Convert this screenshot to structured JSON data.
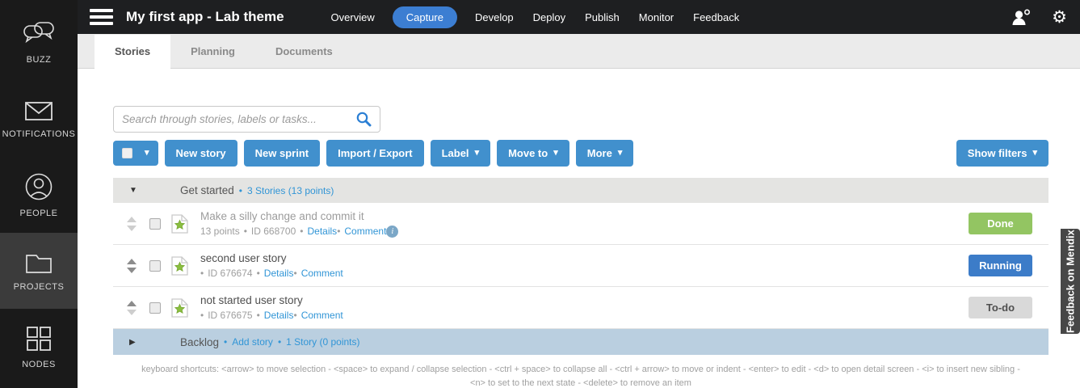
{
  "topbar": {
    "title": "My first app - Lab theme",
    "nav": [
      "Overview",
      "Capture",
      "Develop",
      "Deploy",
      "Publish",
      "Monitor",
      "Feedback"
    ]
  },
  "sidebar": {
    "items": [
      {
        "label": "BUZZ"
      },
      {
        "label": "NOTIFICATIONS"
      },
      {
        "label": "PEOPLE"
      },
      {
        "label": "PROJECTS"
      },
      {
        "label": "NODES"
      }
    ]
  },
  "tabs": [
    "Stories",
    "Planning",
    "Documents"
  ],
  "search": {
    "placeholder": "Search through stories, labels or tasks..."
  },
  "toolbar": {
    "new_story": "New story",
    "new_sprint": "New sprint",
    "import_export": "Import / Export",
    "label": "Label",
    "move_to": "Move to",
    "more": "More",
    "show_filters": "Show filters"
  },
  "sections": {
    "get_started": {
      "label": "Get started",
      "count_link": "3 Stories (13 points)"
    },
    "backlog": {
      "label": "Backlog",
      "add_story_link": "Add story",
      "count_link": "1 Story (0 points)"
    }
  },
  "stories": [
    {
      "title": "Make a silly change and commit it",
      "points": "13 points",
      "id": "ID 668700",
      "details_link": "Details",
      "comment_link": "Comment",
      "status": "Done",
      "badge_css": "background:#93c562;color:#ffffff",
      "title_css": "color:#9c9c9c"
    },
    {
      "title": "second user story",
      "points": "",
      "id": "ID 676674",
      "details_link": "Details",
      "comment_link": "Comment",
      "status": "Running",
      "badge_css": "background:#3c7cc8;color:#ffffff",
      "title_css": "color:#4f4f4f"
    },
    {
      "title": "not started user story",
      "points": "",
      "id": "ID 676675",
      "details_link": "Details",
      "comment_link": "Comment",
      "status": "To-do",
      "badge_css": "background:#d9d9d9;color:#4f4f4f",
      "title_css": "color:#4f4f4f"
    }
  ],
  "shortcuts": "keyboard shortcuts: <arrow> to move selection - <space> to expand / collapse selection - <ctrl + space> to collapse all - <ctrl + arrow> to move or indent - <enter> to edit - <d> to open detail screen - <i> to insert new sibling - <n> to set to the next state - <delete> to remove an item",
  "feedback_tab": "Feedback on Mendix",
  "icons": {
    "caret_down": "▾",
    "collapse": "▼",
    "expand": "▶",
    "bullet": "•",
    "gear": "⚙",
    "info": "i"
  },
  "colors": {
    "accent_link": "#3195d6",
    "button_blue": "#4190cd",
    "nav_active_blue": "#3c7ed2",
    "done_green": "#93c562",
    "running_blue": "#3c7cc8",
    "todo_gray": "#d9d9d9"
  }
}
